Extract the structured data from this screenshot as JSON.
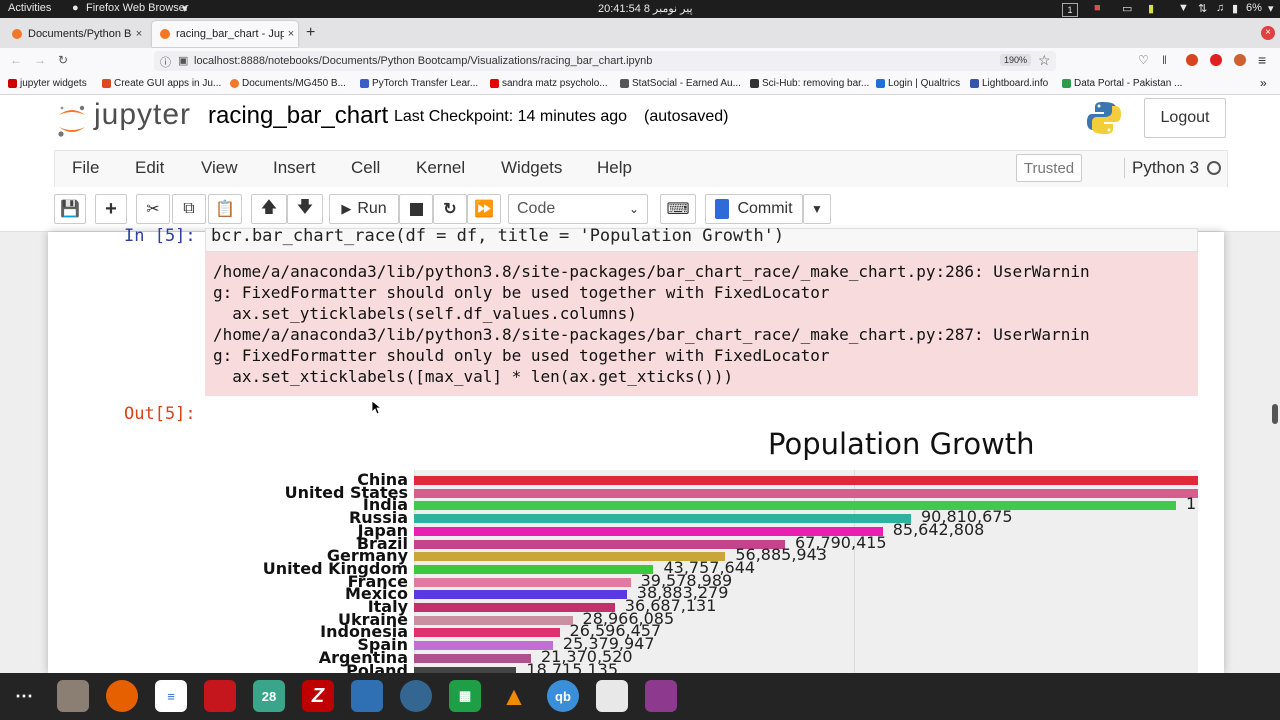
{
  "system_bar": {
    "activities": "Activities",
    "app_menu": "Firefox Web Browser",
    "clock": "20:41:54 پیر نومبر 8",
    "battery": "6%"
  },
  "browser": {
    "tabs": [
      {
        "label": "Documents/Python Boot",
        "active": false
      },
      {
        "label": "racing_bar_chart - Jupyte",
        "active": true
      }
    ],
    "new_tab": "+",
    "url": "localhost:8888/notebooks/Documents/Python Bootcamp/Visualizations/racing_bar_chart.ipynb",
    "zoom": "190%",
    "bookmarks": [
      {
        "label": "jupyter widgets",
        "color": "#cc0000"
      },
      {
        "label": "Create GUI apps in Ju...",
        "color": "#d94a1e"
      },
      {
        "label": "Documents/MG450 B...",
        "color": "#f37726"
      },
      {
        "label": "PyTorch Transfer Lear...",
        "color": "#3a5ec4"
      },
      {
        "label": "sandra matz psycholo...",
        "color": "#e00000"
      },
      {
        "label": "StatSocial - Earned Au...",
        "color": "#555555"
      },
      {
        "label": "Sci-Hub: removing bar...",
        "color": "#333333"
      },
      {
        "label": "Login | Qualtrics",
        "color": "#1e6fd9"
      },
      {
        "label": "Lightboard.info",
        "color": "#3355aa"
      },
      {
        "label": "Data Portal - Pakistan ...",
        "color": "#2a9d4a"
      }
    ]
  },
  "jupyter": {
    "logo_text": "jupyter",
    "notebook_name": "racing_bar_chart",
    "checkpoint": "Last Checkpoint: 14 minutes ago",
    "autosave": "(autosaved)",
    "logout": "Logout",
    "menu": [
      "File",
      "Edit",
      "View",
      "Insert",
      "Cell",
      "Kernel",
      "Widgets",
      "Help"
    ],
    "trusted": "Trusted",
    "kernel": "Python 3",
    "toolbar": {
      "run": "Run",
      "cell_type": "Code",
      "commit": "Commit"
    }
  },
  "cell": {
    "in_prompt": "In [5]:",
    "code": "bcr.bar_chart_race(df = df, title = 'Population Growth')",
    "stderr": [
      "/home/a/anaconda3/lib/python3.8/site-packages/bar_chart_race/_make_chart.py:286: UserWarnin",
      "g: FixedFormatter should only be used together with FixedLocator",
      "  ax.set_yticklabels(self.df_values.columns)",
      "/home/a/anaconda3/lib/python3.8/site-packages/bar_chart_race/_make_chart.py:287: UserWarnin",
      "g: FixedFormatter should only be used together with FixedLocator",
      "  ax.set_xticklabels([max_val] * len(ax.get_xticks()))"
    ],
    "out_prompt": "Out[5]:"
  },
  "chart_data": {
    "type": "bar",
    "title": "Population Growth",
    "orientation": "horizontal",
    "categories": [
      "China",
      "United States",
      "India",
      "Russia",
      "Japan",
      "Brazil",
      "Germany",
      "United Kingdom",
      "France",
      "Mexico",
      "Italy",
      "Ukraine",
      "Indonesia",
      "Spain",
      "Argentina",
      "Poland"
    ],
    "values": [
      null,
      null,
      null,
      90810675,
      85642808,
      67790415,
      56885943,
      43757644,
      39578989,
      38883279,
      36687131,
      28966085,
      26596457,
      25379947,
      21370520,
      18715135
    ],
    "value_labels": [
      "",
      "",
      "1",
      "90,810,675",
      "85,642,808",
      "67,790,415",
      "56,885,943",
      "43,757,644",
      "39,578,989",
      "38,883,279",
      "36,687,131",
      "28,966,085",
      "26,596,457",
      "25,379,947",
      "21,370,520",
      "18,715,135"
    ],
    "colors": [
      "#e0283a",
      "#d95d8c",
      "#40c94a",
      "#2bb3a0",
      "#e81fb0",
      "#c6428c",
      "#c8a63a",
      "#3cc83c",
      "#e07aa0",
      "#5a3ae0",
      "#c0306a",
      "#c890a0",
      "#e0306e",
      "#c070d0",
      "#b0508c",
      "#444444"
    ],
    "grid": true
  },
  "dock": {
    "apps": [
      "apps-grid",
      "files",
      "firefox",
      "text-editor",
      "terminal",
      "calendar",
      "filezilla",
      "virtualbox",
      "pgadmin",
      "spreadsheet",
      "vlc",
      "qbittorrent",
      "document-viewer",
      "screenshot"
    ],
    "calendar_text": "28",
    "qb_text": "qb"
  }
}
